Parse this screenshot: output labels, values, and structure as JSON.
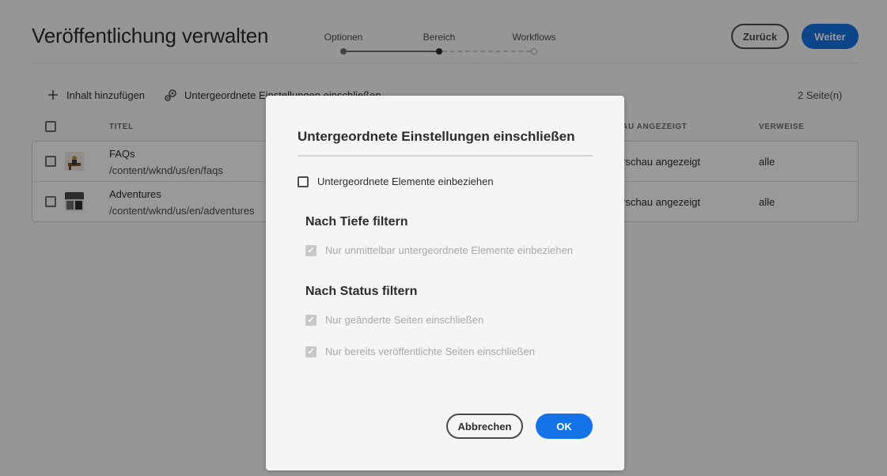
{
  "page": {
    "title": "Veröffentlichung verwalten",
    "wizard_steps": [
      {
        "label": "Optionen",
        "state": "done"
      },
      {
        "label": "Bereich",
        "state": "current"
      },
      {
        "label": "Workflows",
        "state": "upcoming"
      }
    ],
    "back_label": "Zurück",
    "next_label": "Weiter"
  },
  "toolbar": {
    "add_content_label": "Inhalt hinzufügen",
    "add_content_icon": "plus-icon",
    "include_children_label": "Untergeordnete Einstellungen einschließen",
    "include_children_icon": "gears-icon",
    "page_count": "2 Seite(n)"
  },
  "table": {
    "columns": [
      "TITEL",
      "AU ANGEZEIGT",
      "VERWEISE"
    ],
    "rows": [
      {
        "title": "FAQs",
        "path": "/content/wknd/us/en/faqs",
        "preview": "rschau angezeigt",
        "references": "alle"
      },
      {
        "title": "Adventures",
        "path": "/content/wknd/us/en/adventures",
        "preview": "rschau angezeigt",
        "references": "alle"
      }
    ]
  },
  "dialog": {
    "title": "Untergeordnete Einstellungen einschließen",
    "include_children_checkbox": {
      "label": "Untergeordnete Elemente einbeziehen",
      "checked": false,
      "disabled": false
    },
    "depth_section": {
      "heading": "Nach Tiefe filtern",
      "options": [
        {
          "label": "Nur unmittelbar untergeordnete Elemente einbeziehen",
          "checked": true,
          "disabled": true
        }
      ]
    },
    "status_section": {
      "heading": "Nach Status filtern",
      "options": [
        {
          "label": "Nur geänderte Seiten einschließen",
          "checked": true,
          "disabled": true
        },
        {
          "label": "Nur bereits veröffentlichte Seiten einschließen",
          "checked": true,
          "disabled": true
        }
      ]
    },
    "cancel_label": "Abbrechen",
    "ok_label": "OK"
  },
  "colors": {
    "accent": "#1473e6",
    "overlay": "rgba(0,0,0,0.4)",
    "dialog_bg": "#f5f5f5"
  }
}
